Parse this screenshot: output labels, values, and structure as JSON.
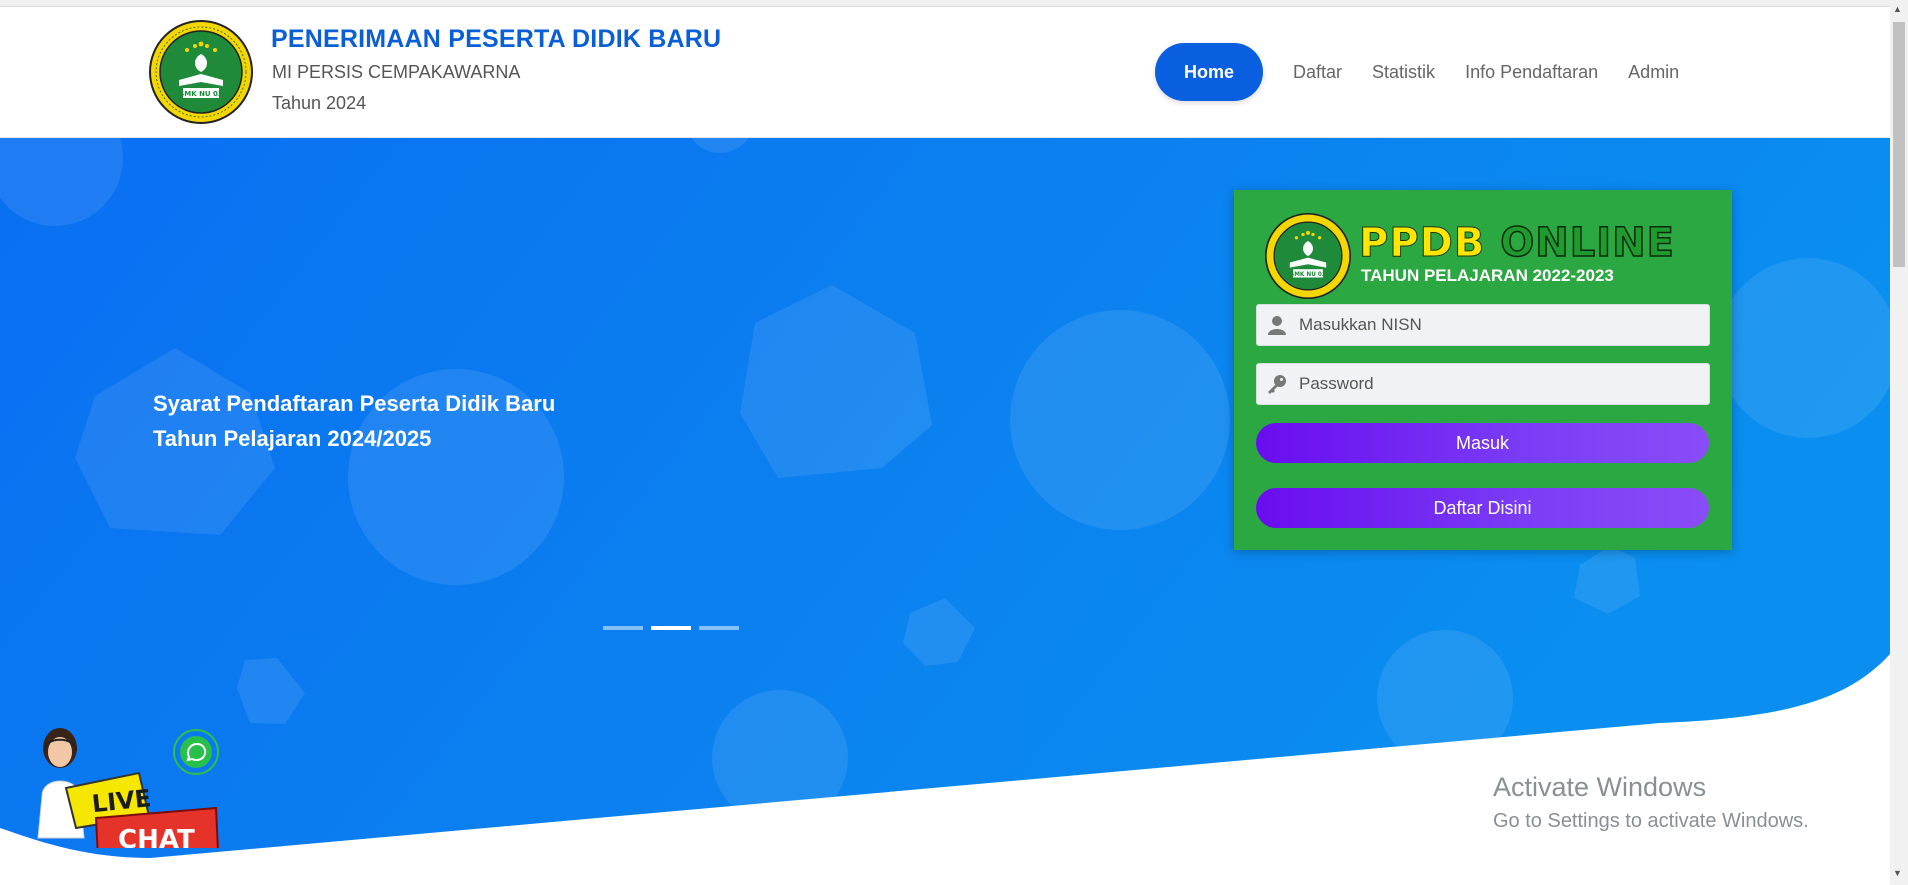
{
  "header": {
    "title": "PENERIMAAN PESERTA DIDIK BARU",
    "school": "MI PERSIS CEMPAKAWARNA",
    "year": "Tahun 2024",
    "logo_text": "SMK NU 03"
  },
  "nav": {
    "items": [
      "Home",
      "Daftar",
      "Statistik",
      "Info Pendaftaran",
      "Admin"
    ],
    "active": "Home",
    "accent_color": "#0a5fe0"
  },
  "hero": {
    "caption_line1": "Syarat Pendaftaran Peserta Didik Baru",
    "caption_line2": "Tahun Pelajaran 2024/2025",
    "slides_total": 3,
    "slide_active_index": 1
  },
  "login": {
    "banner_ppdb": "PPDB",
    "banner_online": "ONLINE",
    "banner_year": "TAHUN PELAJARAN 2022-2023",
    "logo_text": "SMK NU 03",
    "nisn_placeholder": "Masukkan NISN",
    "password_placeholder": "Password",
    "login_button": "Masuk",
    "register_button": "Daftar Disini",
    "card_color": "#2ca843",
    "button_color": "#6a0cf0"
  },
  "live_chat": {
    "line1": "LIVE",
    "line2": "CHAT"
  },
  "watermark": {
    "title": "Activate Windows",
    "subtitle": "Go to Settings to activate Windows."
  }
}
